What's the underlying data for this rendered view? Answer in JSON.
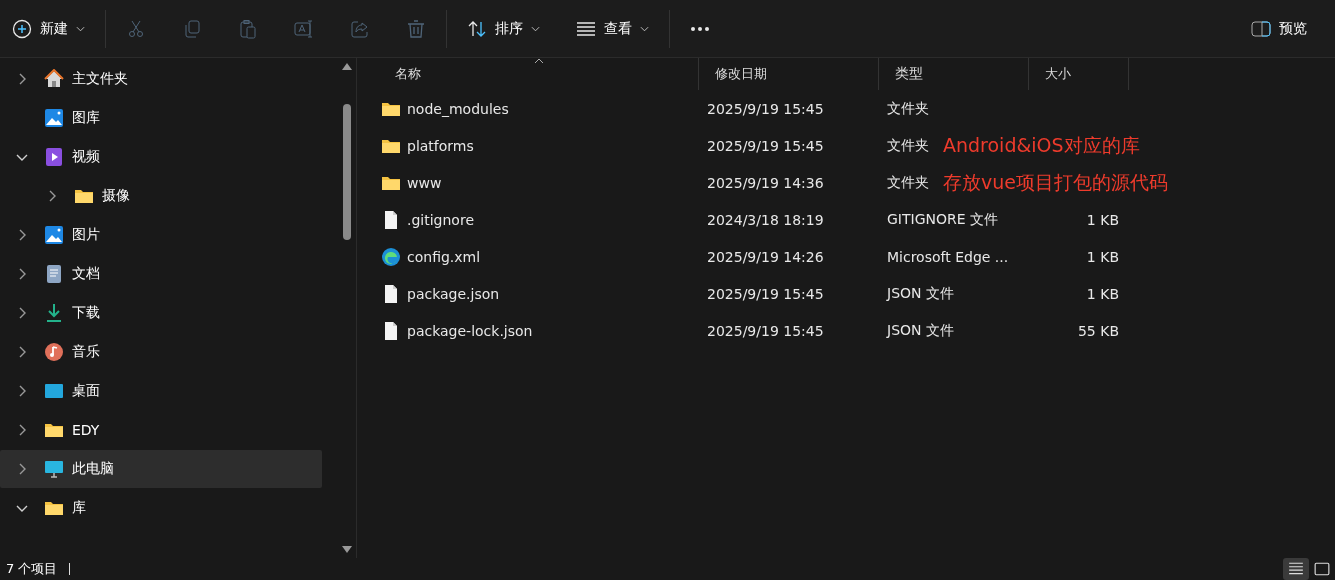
{
  "toolbar": {
    "items": [
      {
        "kind": "new",
        "label": "新建",
        "disabled": false
      },
      {
        "kind": "cut",
        "disabled": true
      },
      {
        "kind": "copy",
        "disabled": true
      },
      {
        "kind": "paste",
        "disabled": true
      },
      {
        "kind": "rename",
        "disabled": true
      },
      {
        "kind": "share",
        "disabled": true
      },
      {
        "kind": "delete",
        "disabled": true
      },
      {
        "kind": "sort",
        "label": "排序",
        "disabled": false
      },
      {
        "kind": "view",
        "label": "查看",
        "disabled": false
      },
      {
        "kind": "more",
        "disabled": false
      }
    ],
    "preview": {
      "label": "预览"
    }
  },
  "sidebar": {
    "items": [
      {
        "kind": "home",
        "label": "主文件夹",
        "expanded": false,
        "selected": false
      },
      {
        "kind": "gallery",
        "label": "图库",
        "selected": false
      },
      {
        "kind": "video",
        "label": "视频",
        "expanded": true,
        "selected": false,
        "children": [
          {
            "kind": "folder",
            "label": "摄像",
            "expanded": false,
            "selected": false
          }
        ]
      },
      {
        "kind": "pictures",
        "label": "图片",
        "expanded": false,
        "selected": false
      },
      {
        "kind": "documents",
        "label": "文档",
        "expanded": false,
        "selected": false
      },
      {
        "kind": "downloads",
        "label": "下载",
        "expanded": false,
        "selected": false
      },
      {
        "kind": "music",
        "label": "音乐",
        "expanded": false,
        "selected": false
      },
      {
        "kind": "desktop",
        "label": "桌面",
        "expanded": false,
        "selected": false
      },
      {
        "kind": "folder",
        "label": "EDY",
        "expanded": false,
        "selected": false
      },
      {
        "kind": "pc",
        "label": "此电脑",
        "expanded": false,
        "selected": true
      },
      {
        "kind": "folder",
        "label": "库",
        "expanded": true,
        "selected": false
      }
    ]
  },
  "table": {
    "columns": [
      {
        "label": "名称",
        "sorted": true
      },
      {
        "label": "修改日期",
        "sorted": false
      },
      {
        "label": "类型",
        "sorted": false
      },
      {
        "label": "大小",
        "sorted": false
      }
    ],
    "rows": [
      {
        "kind": "folder",
        "name": "node_modules",
        "modified": "2025/9/19 15:45",
        "type": "文件夹"
      },
      {
        "kind": "folder",
        "name": "platforms",
        "modified": "2025/9/19 15:45",
        "type": "文件夹",
        "annotation": "Android&iOS对应的库"
      },
      {
        "kind": "folder",
        "name": "www",
        "modified": "2025/9/19 14:36",
        "type": "文件夹",
        "annotation": "存放vue项目打包的源代码"
      },
      {
        "kind": "file",
        "name": ".gitignore",
        "modified": "2024/3/18 18:19",
        "type": "GITIGNORE 文件",
        "size": "1 KB"
      },
      {
        "kind": "edge",
        "name": "config.xml",
        "modified": "2025/9/19 14:26",
        "type": "Microsoft Edge ...",
        "size": "1 KB"
      },
      {
        "kind": "file",
        "name": "package.json",
        "modified": "2025/9/19 15:45",
        "type": "JSON 文件",
        "size": "1 KB"
      },
      {
        "kind": "file",
        "name": "package-lock.json",
        "modified": "2025/9/19 15:45",
        "type": "JSON 文件",
        "size": "55 KB"
      }
    ]
  },
  "status_bar": {
    "count": "7 个项目",
    "view_modes": [
      {
        "kind": "details",
        "selected": true
      },
      {
        "kind": "tiles",
        "selected": false
      }
    ]
  }
}
